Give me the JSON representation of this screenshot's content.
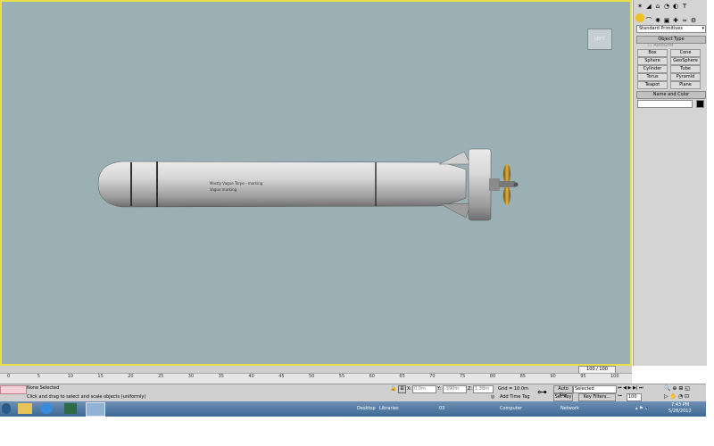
{
  "viewport": {
    "label": "LEFT"
  },
  "torpedo": {
    "text_line1": "Mostly Vague Torpe - marking",
    "text_line2": "Vague marking"
  },
  "panel": {
    "dropdown": "Standard Primitives",
    "autogrid": "AutoGrid",
    "object_type_header": "Object Type",
    "buttons": [
      "Box",
      "Cone",
      "Sphere",
      "GeoSphere",
      "Cylinder",
      "Tube",
      "Torus",
      "Pyramid",
      "Teapot",
      "Plane"
    ],
    "name_color_header": "Name and Color"
  },
  "timeline": {
    "frame": "100 / 100",
    "ticks": [
      "0",
      "5",
      "10",
      "15",
      "20",
      "25",
      "30",
      "35",
      "40",
      "45",
      "50",
      "55",
      "60",
      "65",
      "70",
      "75",
      "80",
      "85",
      "90",
      "95",
      "100"
    ]
  },
  "status": {
    "selection": "None Selected",
    "prompt": "Click and drag to select and scale objects (uniformly)",
    "x_label": "X:",
    "x_value": "0.0m",
    "y_label": "Y:",
    "y_value": "-390m",
    "z_label": "Z:",
    "z_value": "1.38m",
    "grid": "Grid = 10.0m",
    "add_time_tag": "Add Time Tag",
    "auto_key": "Auto Key",
    "set_key": "Set Key",
    "selected_dropdown": "Selected",
    "key_filters": "Key Filters...",
    "frame_field": "100"
  },
  "taskbar": {
    "desktop": "Desktop",
    "libraries": "Libraries",
    "folder": "03",
    "computer": "Computer",
    "network": "Network",
    "time": "7:43 PM",
    "date": "5/28/2012"
  },
  "colors": {
    "viewport_bg": "#9ab0b4",
    "active_border": "#e8e04a",
    "panel_bg": "#d4d4d4"
  }
}
